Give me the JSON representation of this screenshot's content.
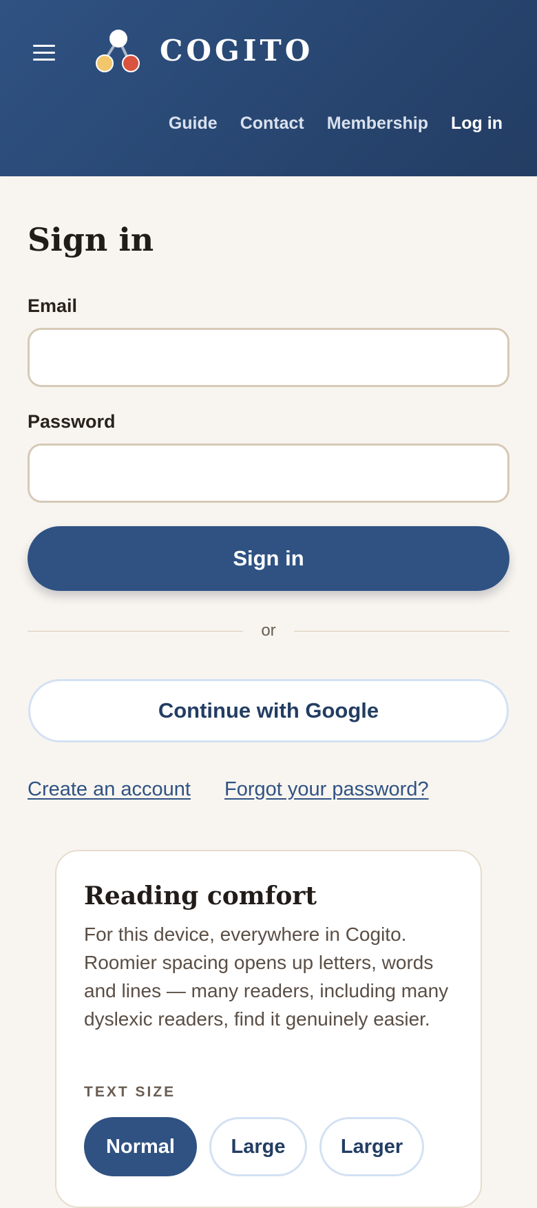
{
  "header": {
    "brand": "COGITO",
    "nav": [
      {
        "label": "Guide"
      },
      {
        "label": "Contact"
      },
      {
        "label": "Membership"
      },
      {
        "label": "Log in"
      }
    ]
  },
  "signin": {
    "title": "Sign in",
    "email_label": "Email",
    "email_value": "",
    "password_label": "Password",
    "password_value": "",
    "submit_label": "Sign in",
    "divider_text": "or",
    "google_label": "Continue with Google",
    "create_account": "Create an account",
    "forgot_password": "Forgot your password?"
  },
  "reading_comfort": {
    "title": "Reading comfort",
    "description": "For this device, everywhere in Cogito. Roomier spacing opens up letters, words and lines — many readers, including many dyslexic readers, find it genuinely easier.",
    "text_size_label": "TEXT SIZE",
    "options": [
      {
        "label": "Normal",
        "selected": true
      },
      {
        "label": "Large",
        "selected": false
      },
      {
        "label": "Larger",
        "selected": false
      }
    ]
  },
  "colors": {
    "header": "#2f5283",
    "primary": "#2f5283",
    "background": "#f8f5f0",
    "logo_yellow": "#f2c66a",
    "logo_red": "#d9533f"
  }
}
